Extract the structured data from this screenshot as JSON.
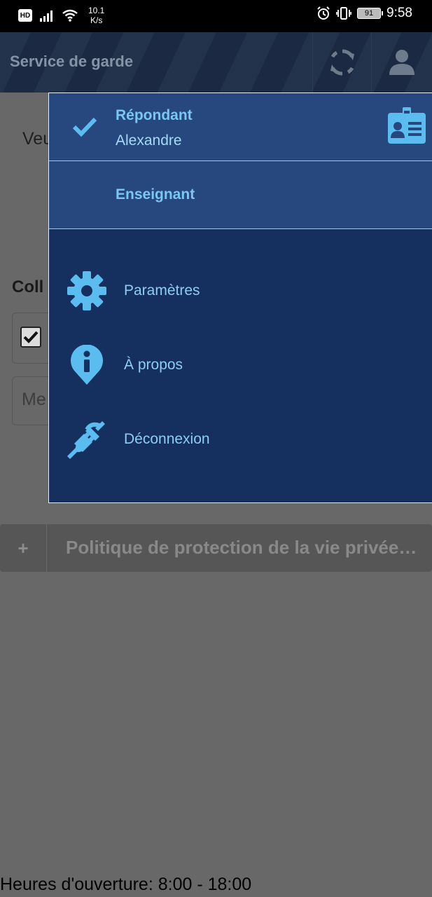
{
  "status_bar": {
    "hd_badge": "HD",
    "net_speed_value": "10.1",
    "net_speed_unit": "K/s",
    "battery": "91",
    "time": "9:58"
  },
  "header": {
    "title": "Service de garde",
    "refresh_icon": "refresh-icon",
    "user_icon": "user-icon"
  },
  "background": {
    "intro_text_fragment": "Veu",
    "section_fragment": "Coll",
    "input_placeholder_fragment": "Me",
    "privacy_toggle": "+",
    "privacy_label": "Politique de protection de la vie privée…",
    "opening_hours": "Heures d'ouverture: 8:00 - 18:00"
  },
  "menu": {
    "accounts": [
      {
        "role": "Répondant",
        "name": "Alexandre",
        "selected": true
      },
      {
        "role": "Enseignant",
        "name": "",
        "selected": false
      }
    ],
    "items": [
      {
        "label": "Paramètres",
        "icon": "gear-icon"
      },
      {
        "label": "À propos",
        "icon": "info-pin-icon"
      },
      {
        "label": "Déconnexion",
        "icon": "plug-icon"
      }
    ]
  },
  "colors": {
    "menu_bg": "#15305e",
    "account_bg": "#27477f",
    "accent": "#5bbcf0",
    "overlay": "#686868"
  }
}
